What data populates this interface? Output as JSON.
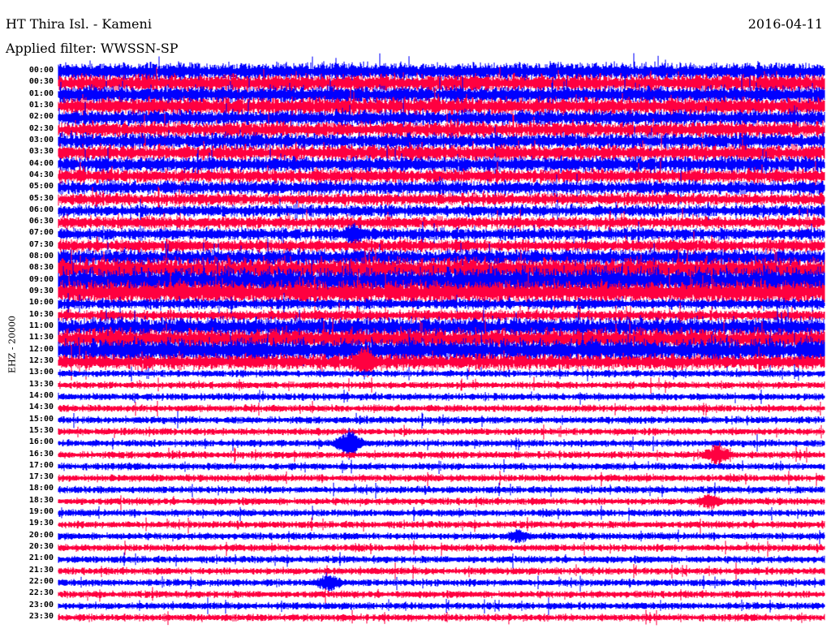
{
  "header": {
    "title": "HT Thira Isl. - Kameni",
    "filter": "Applied filter: WWSSN-SP",
    "date": "2016-04-11"
  },
  "chart_data": {
    "type": "line",
    "title": "HT Thira Isl. - Kameni",
    "ylabel": "EHZ - 20000",
    "minutes_per_row": 30,
    "row_labels": [
      "00:00",
      "00:30",
      "01:00",
      "01:30",
      "02:00",
      "02:30",
      "03:00",
      "03:30",
      "04:00",
      "04:30",
      "05:00",
      "05:30",
      "06:00",
      "06:30",
      "07:00",
      "07:30",
      "08:00",
      "08:30",
      "09:00",
      "09:30",
      "10:00",
      "10:30",
      "11:00",
      "11:30",
      "12:00",
      "12:30",
      "13:00",
      "13:30",
      "14:00",
      "14:30",
      "15:00",
      "15:30",
      "16:00",
      "16:30",
      "17:00",
      "17:30",
      "18:00",
      "18:30",
      "19:00",
      "19:30",
      "20:00",
      "20:30",
      "21:00",
      "21:30",
      "22:00",
      "22:30",
      "23:00",
      "23:30"
    ],
    "row_noise_level": [
      10,
      10,
      10,
      10,
      9,
      9,
      9,
      9,
      9,
      8,
      8,
      7,
      7,
      7,
      7,
      7,
      9,
      13,
      15,
      13,
      6,
      6,
      11,
      12,
      13,
      9,
      4,
      4,
      4,
      4,
      4,
      4,
      4,
      4,
      4,
      4,
      4,
      4,
      4,
      4,
      4,
      4,
      4,
      4,
      4,
      4,
      4,
      4
    ],
    "events": [
      {
        "row": 14,
        "minute": 11.6,
        "amp": 14
      },
      {
        "row": 25,
        "minute": 12.0,
        "amp": 20
      },
      {
        "row": 32,
        "minute": 11.4,
        "amp": 18
      },
      {
        "row": 37,
        "minute": 25.5,
        "amp": 10
      },
      {
        "row": 44,
        "minute": 10.6,
        "amp": 12
      },
      {
        "row": 24,
        "minute": 29.5,
        "amp": 14
      },
      {
        "row": 33,
        "minute": 25.8,
        "amp": 14
      },
      {
        "row": 40,
        "minute": 18.0,
        "amp": 9
      }
    ],
    "colors": [
      "#0000ff",
      "#ff0040"
    ]
  }
}
